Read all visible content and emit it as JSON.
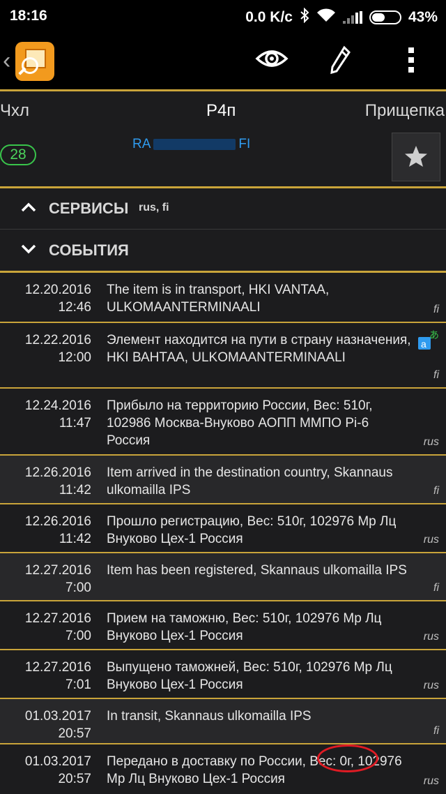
{
  "status_bar": {
    "time": "18:16",
    "network_speed": "0.0 K/c",
    "battery": "43%"
  },
  "toolbar": {
    "back_icon": "chevron-left-icon",
    "logo_icon": "package-search-icon",
    "view_icon": "eye-icon",
    "edit_icon": "pencil-icon",
    "menu_icon": "more-vertical-icon"
  },
  "header": {
    "left_label": "Чхл",
    "center_label": "Р4п",
    "right_label": "Прищепка",
    "day_count": "28",
    "tracking_prefix": "RA",
    "tracking_suffix": "FI",
    "star_icon": "star-icon"
  },
  "sections": {
    "services": {
      "title": "СЕРВИСЫ",
      "subtitle": "rus, fi"
    },
    "events": {
      "title": "СОБЫТИЯ"
    }
  },
  "events": [
    {
      "date": "12.20.2016",
      "time": "12:46",
      "text": "The item is in transport, HKI VANTAA, ULKOMAANTERMINAALI",
      "lang": "fi"
    },
    {
      "date": "12.22.2016",
      "time": "12:00",
      "text": "Элемент находится на пути в страну назначения, HKI ВАНТАА, ULKOMAANTERMINAALI",
      "lang": "fi",
      "translated": true
    },
    {
      "date": "12.24.2016",
      "time": "11:47",
      "text": "Прибыло на территорию России, Вес: 510г, 102986 Москва-Внуково АОПП ММПО Pi-6 Россия",
      "lang": "rus"
    },
    {
      "date": "12.26.2016",
      "time": "11:42",
      "text": "Item arrived in the destination country, Skannaus ulkomailla IPS",
      "lang": "fi"
    },
    {
      "date": "12.26.2016",
      "time": "11:42",
      "text": "Прошло регистрацию, Вес: 510г, 102976 Мр Лц Внуково Цех-1 Россия",
      "lang": "rus"
    },
    {
      "date": "12.27.2016",
      "time": "7:00",
      "text": "Item has been registered, Skannaus ulkomailla IPS",
      "lang": "fi"
    },
    {
      "date": "12.27.2016",
      "time": "7:00",
      "text": "Прием на таможню, Вес: 510г, 102976 Мр Лц Внуково Цех-1 Россия",
      "lang": "rus"
    },
    {
      "date": "12.27.2016",
      "time": "7:01",
      "text": "Выпущено таможней, Вес: 510г, 102976 Мр Лц Внуково Цех-1 Россия",
      "lang": "rus"
    },
    {
      "date": "01.03.2017",
      "time": "20:57",
      "text": "In transit, Skannaus ulkomailla IPS",
      "lang": "fi"
    },
    {
      "date": "01.03.2017",
      "time": "20:57",
      "text": "Передано в доставку по России, Вес: 0г, 102976 Мр Лц Внуково Цех-1 Россия",
      "lang": "rus"
    }
  ],
  "colors": {
    "accent": "#c9a43a",
    "link": "#2f9bef",
    "badge": "#39c44b",
    "highlight": "#e01b24"
  }
}
